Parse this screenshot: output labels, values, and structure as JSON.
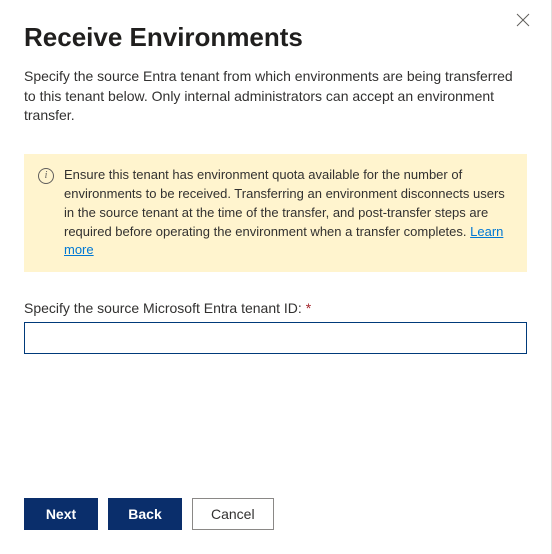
{
  "dialog": {
    "title": "Receive Environments",
    "description": "Specify the source Entra tenant from which environments are being transferred to this tenant below. Only internal administrators can accept an environment transfer."
  },
  "info": {
    "text_before_link": "Ensure this tenant has environment quota available for the number of environments to be received. Transferring an environment disconnects users in the source tenant at the time of the transfer, and post-transfer steps are required before operating the environment when a transfer completes. ",
    "link_label": "Learn more"
  },
  "field": {
    "label": "Specify the source Microsoft Entra tenant ID:",
    "required_mark": "*",
    "value": ""
  },
  "buttons": {
    "next": "Next",
    "back": "Back",
    "cancel": "Cancel"
  }
}
